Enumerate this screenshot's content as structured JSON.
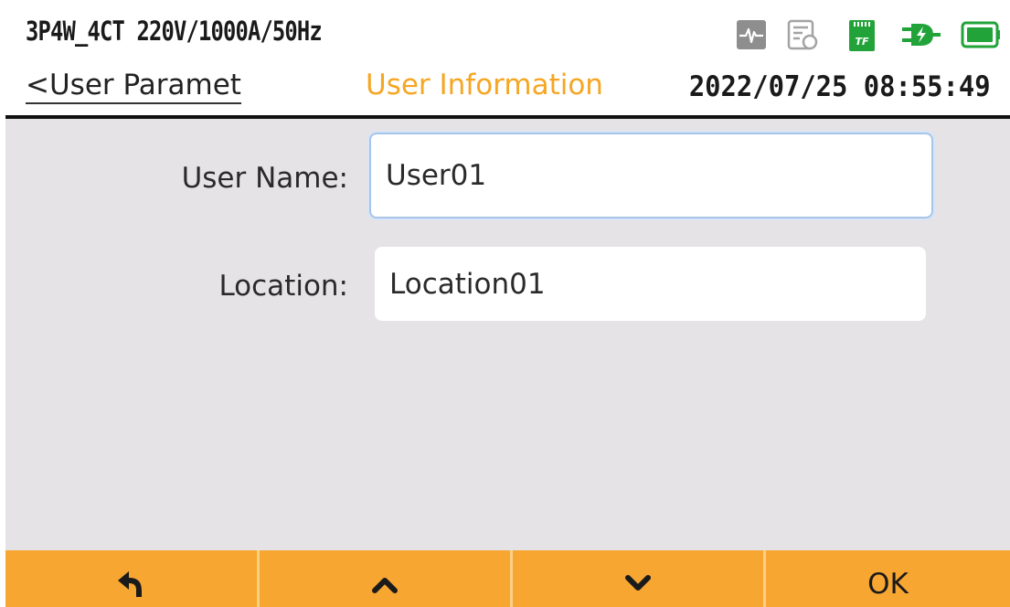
{
  "header": {
    "config": "3P4W_4CT 220V/1000A/50Hz",
    "back_label": "<User Paramet",
    "title": "User Information",
    "datetime": "2022/07/25 08:55:49"
  },
  "status_icons": [
    {
      "name": "waveform-icon",
      "color": "#8e8e8e"
    },
    {
      "name": "log-file-icon",
      "color": "#a3a3a3"
    },
    {
      "name": "tf-card-icon",
      "color": "#22a33a",
      "text": "TF"
    },
    {
      "name": "power-plug-icon",
      "color": "#22a33a"
    },
    {
      "name": "battery-icon",
      "color": "#22a33a"
    }
  ],
  "form": {
    "user_name_label": "User Name:",
    "user_name_value": "User01",
    "location_label": "Location:",
    "location_value": "Location01"
  },
  "toolbar": {
    "buttons": [
      {
        "name": "back-arrow-icon"
      },
      {
        "name": "chevron-up-icon"
      },
      {
        "name": "chevron-down-icon"
      },
      {
        "label": "OK"
      }
    ]
  },
  "colors": {
    "accent": "#f5a623",
    "content_bg": "#e6e3e6",
    "status_green": "#22a33a"
  }
}
